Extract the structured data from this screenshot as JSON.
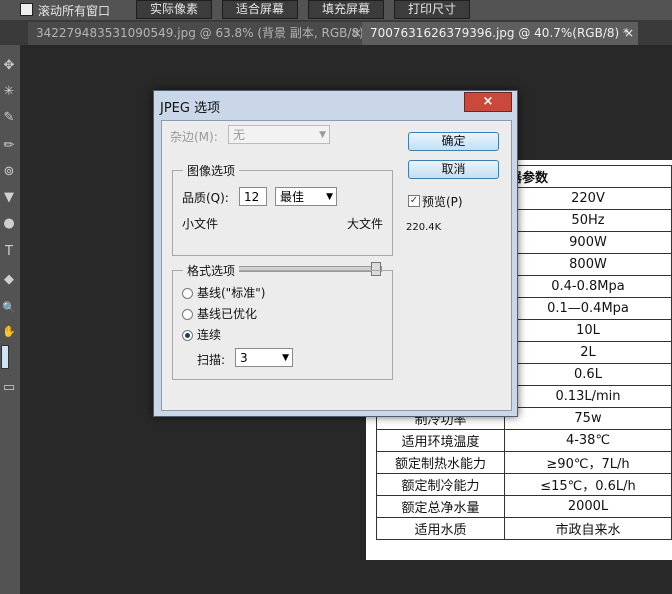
{
  "options_bar": {
    "scroll_all_label": "滚动所有窗口",
    "buttons": [
      "实际像素",
      "适合屏幕",
      "填充屏幕",
      "打印尺寸"
    ]
  },
  "tabs": [
    {
      "label": "342279483531090549.jpg @ 63.8% (背景 副本, RGB/8) *",
      "close": "×"
    },
    {
      "label": "7007631626379396.jpg @ 40.7%(RGB/8) *",
      "close": "×"
    }
  ],
  "tools": {
    "move": "✥",
    "wand": "✳",
    "eyedropper": "✎",
    "brush": "✏",
    "stamp": "⊚",
    "bucket": "▼",
    "dodge": "●",
    "type": "T",
    "shape": "◆",
    "zoom": "🔍",
    "hand": "✋",
    "screen": "▭"
  },
  "table": {
    "header_partial": "器参数",
    "rows": [
      {
        "key": "",
        "value": "220V"
      },
      {
        "key": "",
        "value": "50Hz"
      },
      {
        "key": "",
        "value": "900W"
      },
      {
        "key": "",
        "value": "800W"
      },
      {
        "key": "",
        "value": "0.4-0.8Mpa"
      },
      {
        "key": "",
        "value": "0.1—0.4Mpa"
      },
      {
        "key": "",
        "value": "10L"
      },
      {
        "key": "",
        "value": "2L"
      },
      {
        "key": "",
        "value": "0.6L"
      },
      {
        "key": "",
        "value": "0.13L/min"
      },
      {
        "key": "制冷功率",
        "value": "75w"
      },
      {
        "key": "适用环境温度",
        "value": "4-38℃"
      },
      {
        "key": "额定制热水能力",
        "value": "≥90℃，7L/h"
      },
      {
        "key": "额定制冷能力",
        "value": "≤15℃，0.6L/h"
      },
      {
        "key": "额定总净水量",
        "value": "2000L"
      },
      {
        "key": "适用水质",
        "value": "市政自来水"
      }
    ]
  },
  "dialog": {
    "title": "JPEG 选项",
    "close": "×",
    "matte_label": "杂边(M):",
    "matte_value": "无",
    "image_options": {
      "title": "图像选项",
      "quality_label": "品质(Q):",
      "quality_value": "12",
      "quality_preset": "最佳",
      "small_file": "小文件",
      "large_file": "大文件"
    },
    "format_options": {
      "title": "格式选项",
      "baseline_standard": "基线(\"标准\")",
      "baseline_optimized": "基线已优化",
      "progressive": "连续",
      "scans_label": "扫描:",
      "scans_value": "3",
      "selected": "progressive"
    },
    "ok_label": "确定",
    "cancel_label": "取消",
    "preview_label": "预览(P)",
    "preview_checked": true,
    "file_size": "220.4K",
    "slider_fraction": 1.0
  }
}
